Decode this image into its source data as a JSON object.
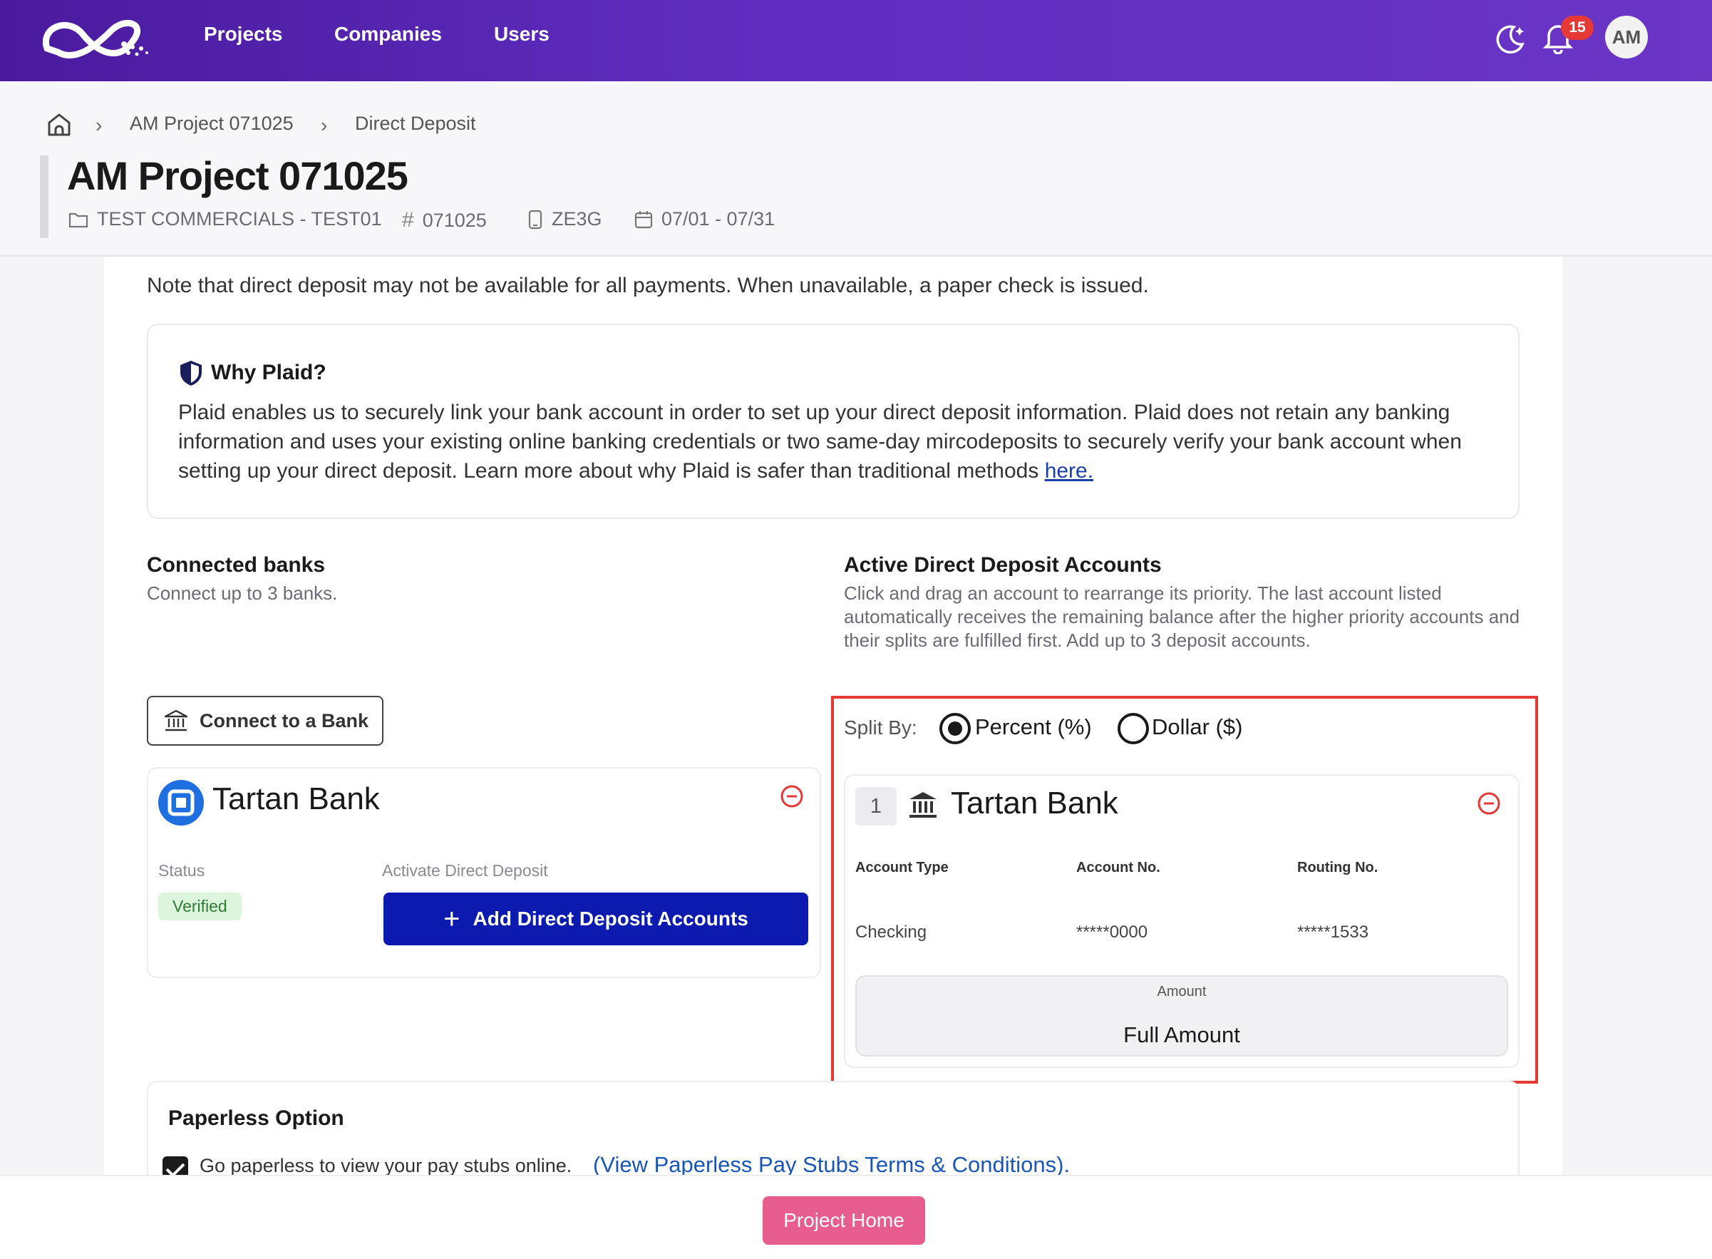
{
  "nav": {
    "items": [
      "Projects",
      "Companies",
      "Users"
    ],
    "notifications": "15",
    "avatar": "AM"
  },
  "breadcrumb": [
    "AM Project 071025",
    "Direct Deposit"
  ],
  "header": {
    "title": "AM Project 071025",
    "company": "TEST COMMERCIALS - TEST01",
    "number": "071025",
    "code": "ZE3G",
    "dates": "07/01 - 07/31"
  },
  "note": "Note that direct deposit may not be available for all payments. When unavailable, a paper check is issued.",
  "why": {
    "title": "Why Plaid?",
    "text": "Plaid enables us to securely link your bank account in order to set up your direct deposit information. Plaid does not retain any banking information and uses your existing online banking credentials or two same-day mircodeposits to securely verify your bank account when setting up your direct deposit. Learn more about why Plaid is safer than traditional methods ",
    "link": "here."
  },
  "connected": {
    "title": "Connected banks",
    "subtitle": "Connect up to 3 banks.",
    "connect_button": "Connect to a Bank",
    "bank": {
      "name": "Tartan Bank",
      "status_label": "Status",
      "status": "Verified",
      "activate_label": "Activate Direct Deposit",
      "add_button": "Add Direct Deposit Accounts"
    }
  },
  "active": {
    "title": "Active Direct Deposit Accounts",
    "subtitle": "Click and drag an account to rearrange its priority. The last account listed automatically receives the remaining balance after the higher priority accounts and their splits are fulfilled first. Add up to 3 deposit accounts.",
    "split_label": "Split By:",
    "split_options": [
      "Percent (%)",
      "Dollar ($)"
    ],
    "account": {
      "priority": "1",
      "bank": "Tartan Bank",
      "headers": [
        "Account Type",
        "Account No.",
        "Routing No."
      ],
      "values": [
        "Checking",
        "*****0000",
        "*****1533"
      ],
      "amount_label": "Amount",
      "amount": "Full Amount"
    }
  },
  "paperless": {
    "title": "Paperless Option",
    "text": "Go paperless to view your pay stubs online.",
    "link": "(View Paperless Pay Stubs Terms & Conditions)."
  },
  "footer": {
    "home_button": "Project Home"
  }
}
